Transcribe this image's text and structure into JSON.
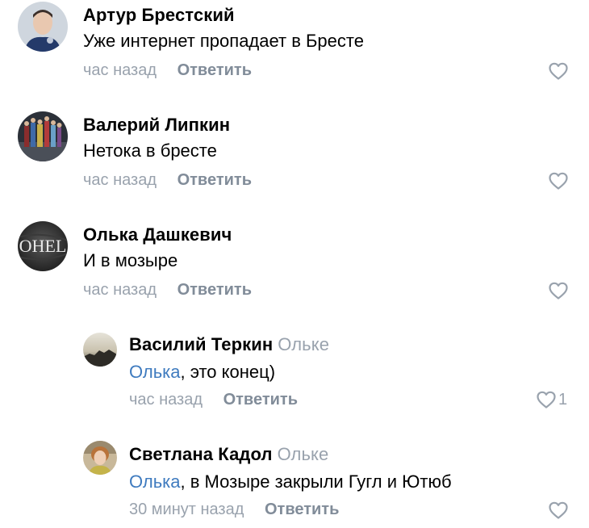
{
  "comments": [
    {
      "author": "Артур Брестский",
      "reply_to": "",
      "mention": "",
      "text": "Уже интернет пропадает в Бресте",
      "time": "час назад",
      "reply_label": "Ответить",
      "likes": ""
    },
    {
      "author": "Валерий Липкин",
      "reply_to": "",
      "mention": "",
      "text": "Нетока в бресте",
      "time": "час назад",
      "reply_label": "Ответить",
      "likes": ""
    },
    {
      "author": "Олька Дашкевич",
      "reply_to": "",
      "mention": "",
      "text": "И в мозыре",
      "time": "час назад",
      "reply_label": "Ответить",
      "likes": "",
      "avatar_text": "OHEL"
    },
    {
      "author": "Василий Теркин",
      "reply_to": "Ольке",
      "mention": "Олька",
      "text": ", это конец)",
      "time": "час назад",
      "reply_label": "Ответить",
      "likes": "1"
    },
    {
      "author": "Светлана Кадол",
      "reply_to": "Ольке",
      "mention": "Олька",
      "text": ", в Мозыре закрыли Гугл и Ютюб",
      "time": "30 минут назад",
      "reply_label": "Ответить",
      "likes": ""
    }
  ],
  "colors": {
    "meta": "#99a2ad",
    "reply_button": "#818c99",
    "mention": "#3f7bbf",
    "heart": "#99a2ad"
  }
}
